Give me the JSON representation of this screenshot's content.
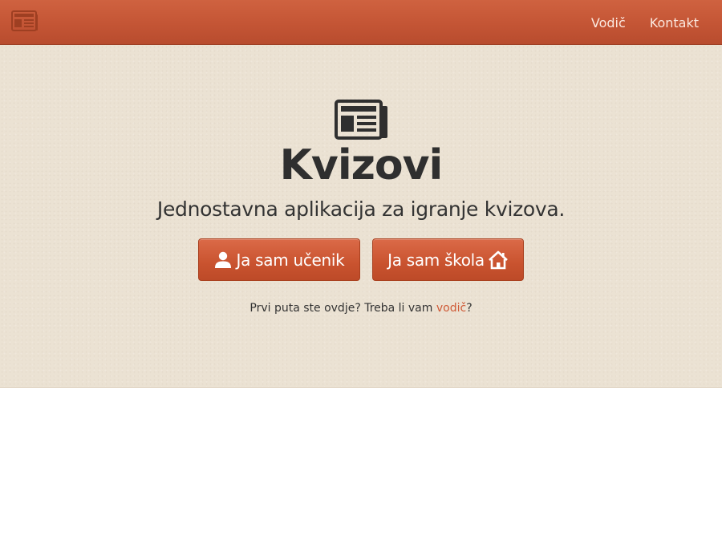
{
  "navbar": {
    "brand_icon": "newspaper-icon",
    "links": [
      {
        "label": "Vodič"
      },
      {
        "label": "Kontakt"
      }
    ],
    "color": "#c45535"
  },
  "hero": {
    "icon": "newspaper-icon",
    "title": "Kvizovi",
    "subtitle": "Jednostavna aplikacija za igranje kvizova.",
    "buttons": {
      "student": {
        "label": "Ja sam učenik",
        "icon": "user-icon"
      },
      "school": {
        "label": "Ja sam škola",
        "icon": "home-icon"
      }
    },
    "help": {
      "prefix": "Prvi puta ste ovdje? Treba li vam ",
      "link": "vodič",
      "suffix": "?"
    },
    "background": "#ebe2d3",
    "accent": "#cf5a36"
  }
}
